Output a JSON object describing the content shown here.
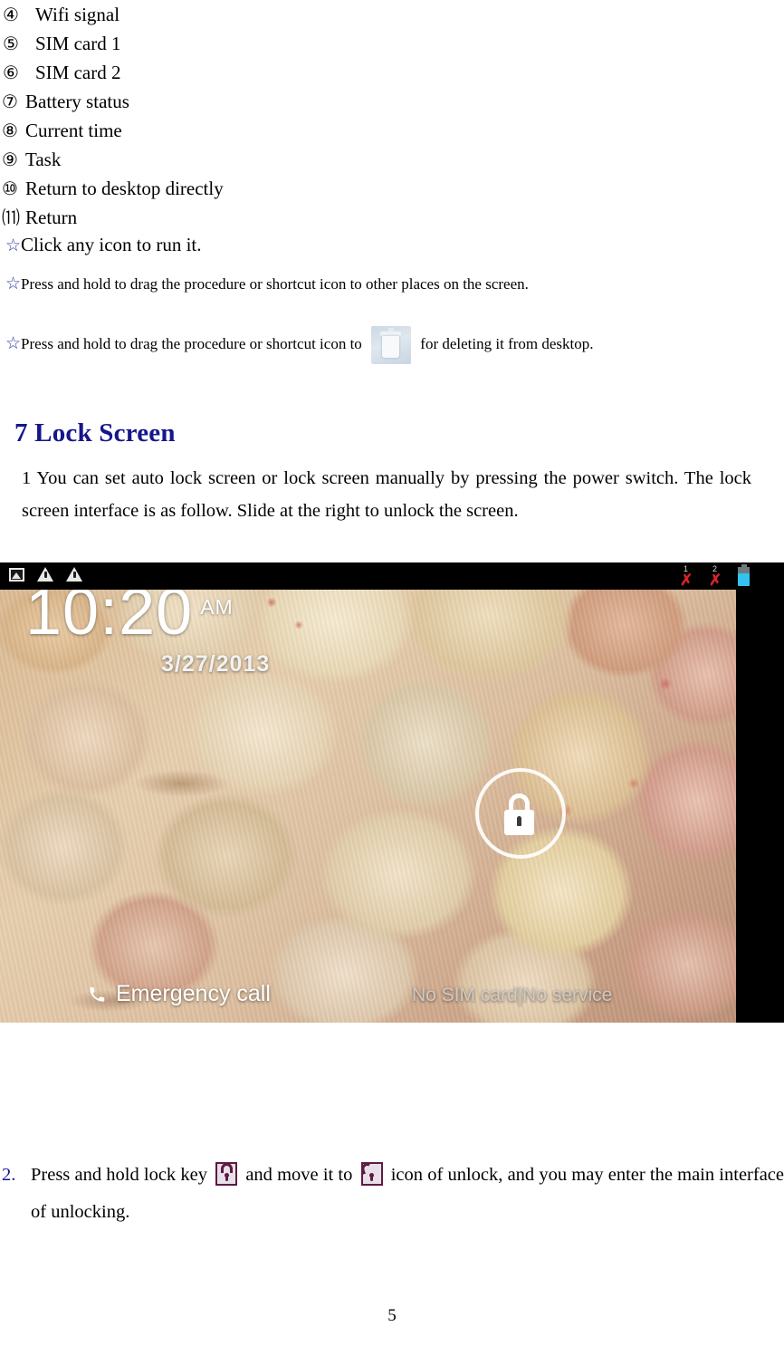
{
  "document": {
    "page_number": "5",
    "legend_items": [
      {
        "marker": "④",
        "label": "Wifi signal",
        "spacing": "wide"
      },
      {
        "marker": "⑤",
        "label": "SIM card 1",
        "spacing": "wide"
      },
      {
        "marker": "⑥",
        "label": "SIM card 2",
        "spacing": "wide"
      },
      {
        "marker": "⑦",
        "label": "Battery status",
        "spacing": "tight"
      },
      {
        "marker": "⑧",
        "label": "Current time",
        "spacing": "tight"
      },
      {
        "marker": "⑨",
        "label": "Task",
        "spacing": "tight"
      },
      {
        "marker": "⑩",
        "label": "Return to desktop directly",
        "spacing": "tight"
      },
      {
        "marker": "⑾",
        "label": "Return",
        "spacing": "tight"
      }
    ],
    "star_bullets": {
      "glyph": "☆",
      "line1": "Click any icon to run it.",
      "line2": "Press and hold to drag the procedure or shortcut icon to other places on the screen.",
      "line3_before": "Press and hold to drag the procedure or shortcut icon to",
      "line3_after": "for deleting it from desktop."
    },
    "section": {
      "heading": "7 Lock Screen",
      "heading_color": "#16168c",
      "body": "1 You can set auto lock screen or lock screen manually by pressing the power switch. The lock screen interface is as follow. Slide at the right to unlock the screen."
    },
    "step2": {
      "number": "2.",
      "text_part1": "Press and hold lock key",
      "text_part2": "and move it to",
      "text_part3": "icon of unlock, and you may enter the main interface of unlocking."
    }
  },
  "lockscreen_figure": {
    "statusbar": {
      "left_icons": [
        "gallery-icon",
        "warning-icon",
        "warning-icon"
      ],
      "sim1_label": "1",
      "sim1_state": "✗",
      "sim2_label": "2",
      "sim2_state": "✗",
      "battery_color": "#32c3f0"
    },
    "clock": {
      "time": "10:20",
      "ampm": "AM",
      "date": "3/27/2013"
    },
    "lock_ring": {
      "icon": "padlock-locked-icon"
    },
    "footer": {
      "emergency_call": "Emergency call",
      "service_status": "No SIM card|No service"
    },
    "wallpaper": "seashell-collage"
  }
}
